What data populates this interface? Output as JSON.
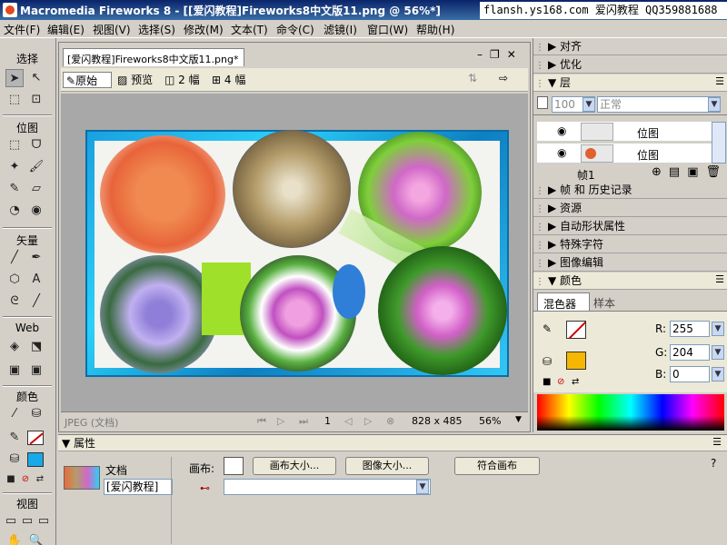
{
  "window": {
    "title": "Macromedia Fireworks 8 - [[爱闪教程]Fireworks8中文版11.png @ 56%*]",
    "watermark": "flansh.ys168.com 爱闪教程 QQ359881688"
  },
  "menu": [
    "文件(F)",
    "编辑(E)",
    "视图(V)",
    "选择(S)",
    "修改(M)",
    "文本(T)",
    "命令(C)",
    "滤镜(I)",
    "窗口(W)",
    "帮助(H)"
  ],
  "toolbox": {
    "select": "选择",
    "bitmap": "位图",
    "vector": "矢量",
    "web": "Web",
    "colors": "颜色",
    "view": "视图"
  },
  "document": {
    "tab": "[爱闪教程]Fireworks8中文版11.png*",
    "views": {
      "original": "原始",
      "preview": "预览",
      "two_up": "2 幅",
      "four_up": "4 幅"
    },
    "format": "JPEG (文档)",
    "frame": "1",
    "size": "828 x 485",
    "zoom": "56%"
  },
  "panels": {
    "align": "对齐",
    "optimize": "优化",
    "layers": "层",
    "opacity": "100",
    "blend": "正常",
    "layer_rows": [
      {
        "name": "位图"
      },
      {
        "name": "位图"
      }
    ],
    "frame_label": "帧1",
    "frames_history": "帧 和 历史记录",
    "assets": "资源",
    "autoshape": "自动形状属性",
    "special_chars": "特殊字符",
    "image_edit": "图像编辑",
    "color": "颜色",
    "mixer_tab": "混色器",
    "swatches_tab": "样本",
    "r_label": "R:",
    "r": "255",
    "g_label": "G:",
    "g": "204",
    "b_label": "B:",
    "b": "0"
  },
  "properties": {
    "title": "属性",
    "doc_label": "文档",
    "doc_name": "[爱闪教程]",
    "canvas_label": "画布:",
    "canvas_size": "画布大小...",
    "image_size": "图像大小...",
    "fit_canvas": "符合画布",
    "help": "?"
  },
  "colors": {
    "fill": "#f5b700",
    "stroke_none": "#d00000",
    "titlebar": "#0a246a"
  }
}
